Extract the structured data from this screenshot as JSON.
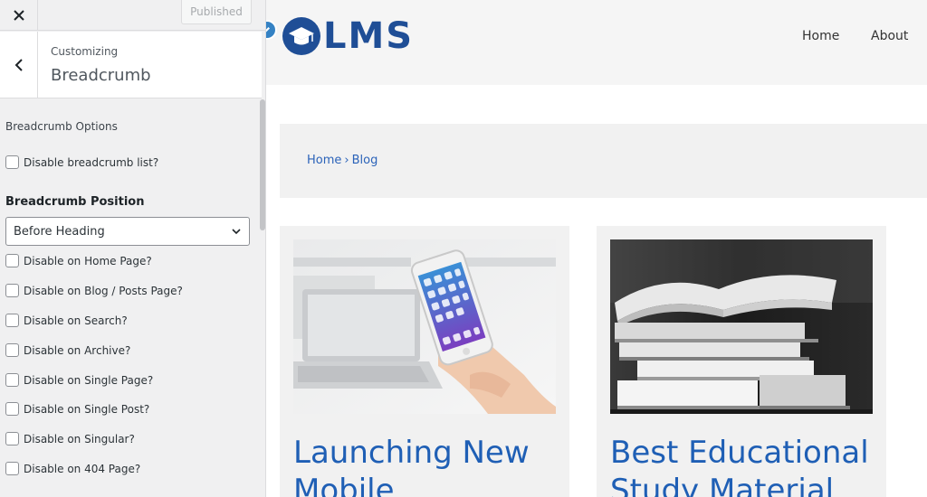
{
  "customizer": {
    "close_icon": "close-icon",
    "published_label": "Published",
    "back_icon": "chevron-left-icon",
    "customizing_label": "Customizing",
    "section_title": "Breadcrumb",
    "options_heading": "Breadcrumb Options",
    "disable_list_label": "Disable breadcrumb list?",
    "position_heading": "Breadcrumb Position",
    "position_value": "Before Heading",
    "checkboxes": [
      "Disable on Home Page?",
      "Disable on Blog / Posts Page?",
      "Disable on Search?",
      "Disable on Archive?",
      "Disable on Single Page?",
      "Disable on Single Post?",
      "Disable on Singular?",
      "Disable on 404 Page?"
    ]
  },
  "site": {
    "logo_text": "LMS",
    "nav": [
      "Home",
      "About"
    ],
    "breadcrumb": {
      "home": "Home",
      "separator": "›",
      "current": "Blog"
    },
    "posts": [
      {
        "title": "Launching New Mobile",
        "image": "phone-laptop-photo"
      },
      {
        "title": "Best Educational Study Material",
        "image": "books-stack-photo"
      }
    ]
  },
  "colors": {
    "brand": "#1f4e96",
    "link": "#2b63b9",
    "post_title": "#1f5fb5",
    "wp_blue": "#3582c4"
  }
}
